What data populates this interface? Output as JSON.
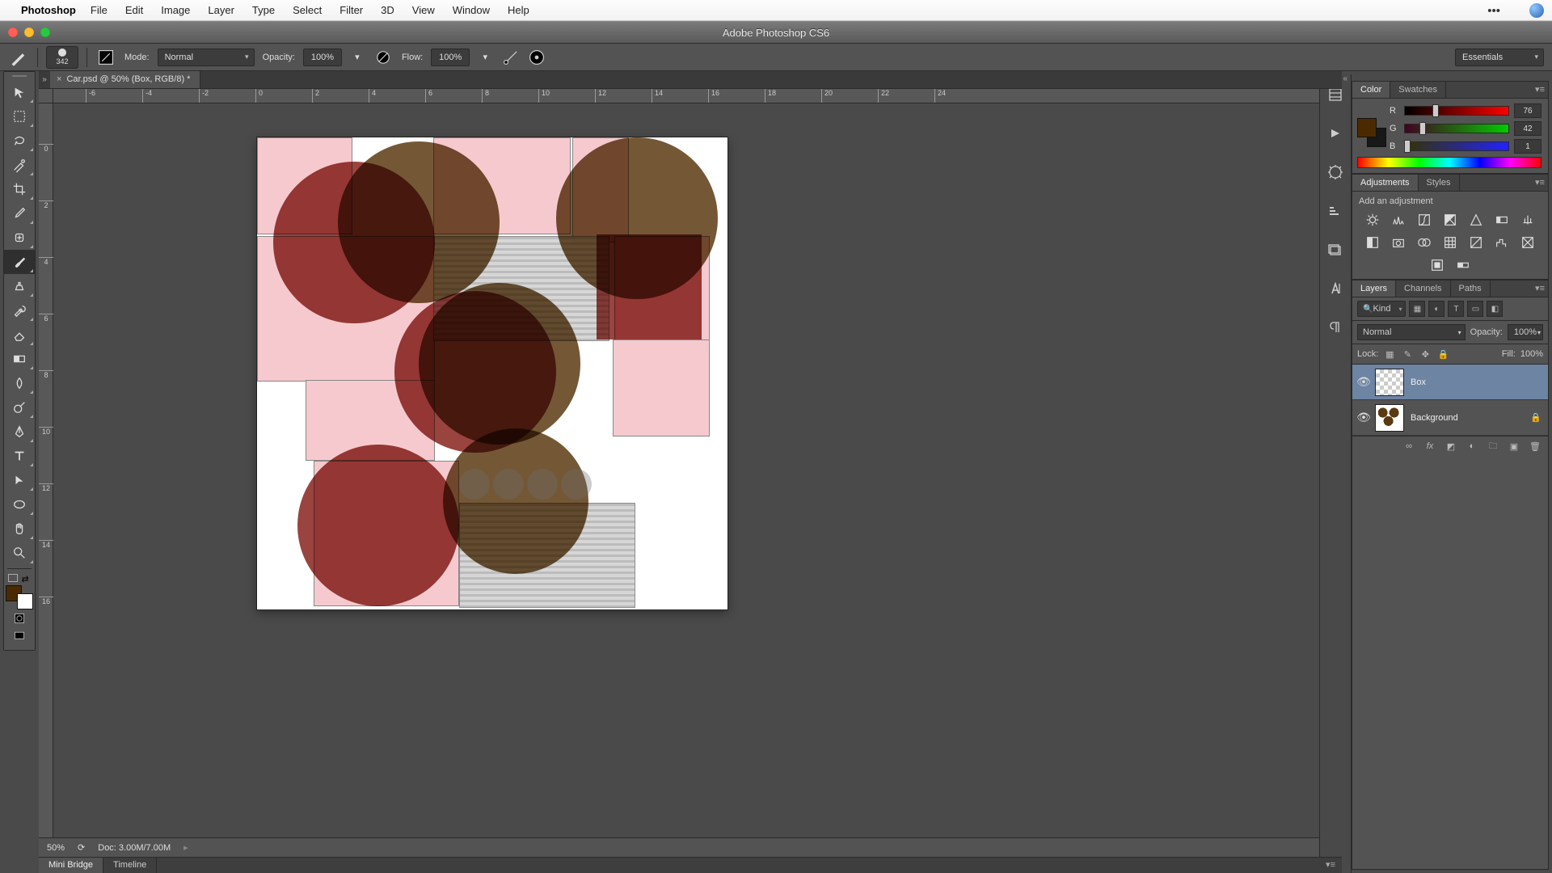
{
  "mac_menu": {
    "app": "Photoshop",
    "items": [
      "File",
      "Edit",
      "Image",
      "Layer",
      "Type",
      "Select",
      "Filter",
      "3D",
      "View",
      "Window",
      "Help"
    ]
  },
  "window_title": "Adobe Photoshop CS6",
  "options_bar": {
    "brush_size": "342",
    "mode_label": "Mode:",
    "mode_value": "Normal",
    "opacity_label": "Opacity:",
    "opacity_value": "100%",
    "flow_label": "Flow:",
    "flow_value": "100%",
    "workspace": "Essentials"
  },
  "document_tab": "Car.psd @ 50% (Box, RGB/8) *",
  "ruler_h": [
    "-6",
    "-4",
    "-2",
    "0",
    "2",
    "4",
    "6",
    "8",
    "10",
    "12",
    "14",
    "16",
    "18",
    "20",
    "22",
    "24"
  ],
  "ruler_v": [
    "0",
    "2",
    "4",
    "6",
    "8",
    "10",
    "12",
    "14",
    "16"
  ],
  "status": {
    "zoom": "50%",
    "doc": "Doc: 3.00M/7.00M"
  },
  "bottom_tabs": [
    "Mini Bridge",
    "Timeline"
  ],
  "color_panel": {
    "tabs": [
      "Color",
      "Swatches"
    ],
    "r": "76",
    "g": "42",
    "b": "1",
    "fg_color": "#4c2a01"
  },
  "adjustments_panel": {
    "tabs": [
      "Adjustments",
      "Styles"
    ],
    "title": "Add an adjustment"
  },
  "layers_panel": {
    "tabs": [
      "Layers",
      "Channels",
      "Paths"
    ],
    "filter_kind": "Kind",
    "blend_mode": "Normal",
    "opacity_label": "Opacity:",
    "opacity_value": "100%",
    "lock_label": "Lock:",
    "fill_label": "Fill:",
    "fill_value": "100%",
    "layers": [
      {
        "name": "Box",
        "selected": true,
        "visible": true,
        "locked": false,
        "thumb": "checker"
      },
      {
        "name": "Background",
        "selected": false,
        "visible": true,
        "locked": true,
        "thumb": "art"
      }
    ]
  }
}
